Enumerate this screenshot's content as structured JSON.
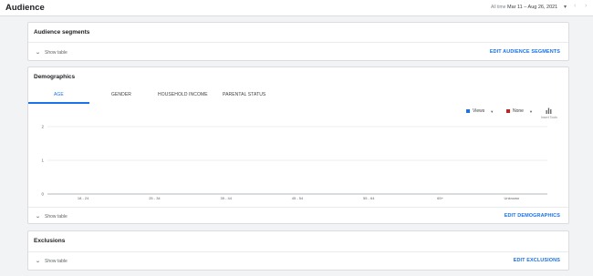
{
  "header": {
    "title": "Audience",
    "range_label": "All time",
    "range_value": "Mar 11 – Aug 26, 2021",
    "range_caret": "▾",
    "prev": "‹",
    "next": "›"
  },
  "segments": {
    "title": "Audience segments",
    "show_table": "Show table",
    "action": "EDIT AUDIENCE SEGMENTS"
  },
  "demographics": {
    "title": "Demographics",
    "tabs": [
      {
        "label": "AGE",
        "active": true
      },
      {
        "label": "GENDER",
        "active": false
      },
      {
        "label": "HOUSEHOLD INCOME",
        "active": false
      },
      {
        "label": "PARENTAL STATUS",
        "active": false
      }
    ],
    "metric1": {
      "label": "Views",
      "color": "#1a73e8"
    },
    "metric2": {
      "label": "None",
      "color": "#c5221f"
    },
    "insert_label": "Insert Tools",
    "show_table": "Show table",
    "action": "EDIT DEMOGRAPHICS"
  },
  "exclusions": {
    "title": "Exclusions",
    "show_table": "Show table",
    "action": "EDIT EXCLUSIONS"
  },
  "chart_data": {
    "type": "bar",
    "categories": [
      "18 - 24",
      "25 - 34",
      "35 - 44",
      "45 - 54",
      "55 - 64",
      "65+",
      "Unknown"
    ],
    "series": [
      {
        "name": "Views",
        "values": [
          0,
          0,
          0,
          0,
          0,
          0,
          0
        ]
      }
    ],
    "yticks": [
      0,
      1,
      2
    ],
    "ylim": [
      0,
      2
    ],
    "grid": true
  }
}
